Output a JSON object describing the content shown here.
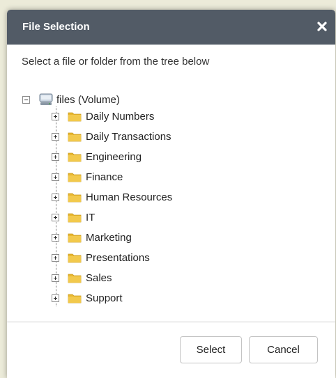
{
  "dialog": {
    "title": "File Selection",
    "close_icon": "close-icon",
    "instructions": "Select a file or folder from the tree below"
  },
  "tree": {
    "root": {
      "label": "files (Volume)",
      "icon": "volume-icon",
      "expanded": true
    },
    "folders": [
      {
        "label": "Daily Numbers"
      },
      {
        "label": "Daily Transactions"
      },
      {
        "label": "Engineering"
      },
      {
        "label": "Finance"
      },
      {
        "label": "Human Resources"
      },
      {
        "label": "IT"
      },
      {
        "label": "Marketing"
      },
      {
        "label": "Presentations"
      },
      {
        "label": "Sales"
      },
      {
        "label": "Support"
      }
    ]
  },
  "buttons": {
    "select_label": "Select",
    "cancel_label": "Cancel"
  },
  "colors": {
    "titlebar": "#525b66",
    "folder": "#f2c94c"
  }
}
